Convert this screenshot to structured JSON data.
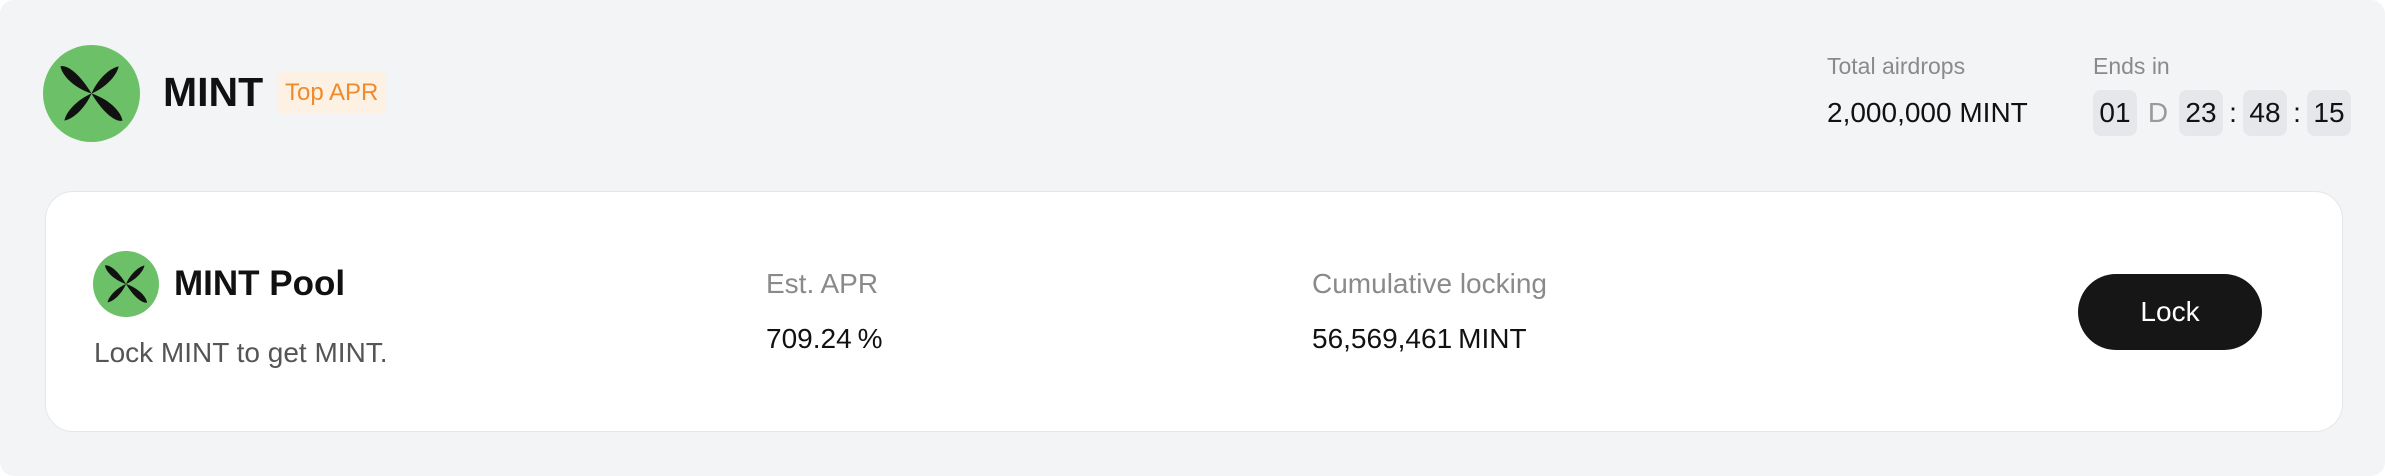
{
  "header": {
    "token_name": "MINT",
    "badge": "Top APR",
    "total_airdrops_label": "Total airdrops",
    "total_airdrops_value": "2,000,000 MINT",
    "ends_in_label": "Ends in",
    "countdown": {
      "days": "01",
      "day_unit": "D",
      "hours": "23",
      "minutes": "48",
      "seconds": "15",
      "separator": ":"
    }
  },
  "pool": {
    "title": "MINT Pool",
    "description": "Lock MINT to get MINT.",
    "apr_label": "Est. APR",
    "apr_value": "709.24",
    "apr_unit": "%",
    "cumulative_label": "Cumulative locking",
    "cumulative_value": "56,569,461",
    "cumulative_unit": "MINT",
    "action_label": "Lock"
  },
  "colors": {
    "logo_bg": "#6cc067",
    "badge_text": "#f08a2c",
    "badge_bg": "#fdf1e4",
    "button_bg": "#161616"
  },
  "icons": {
    "token_logo": "mint-leaf-icon"
  }
}
